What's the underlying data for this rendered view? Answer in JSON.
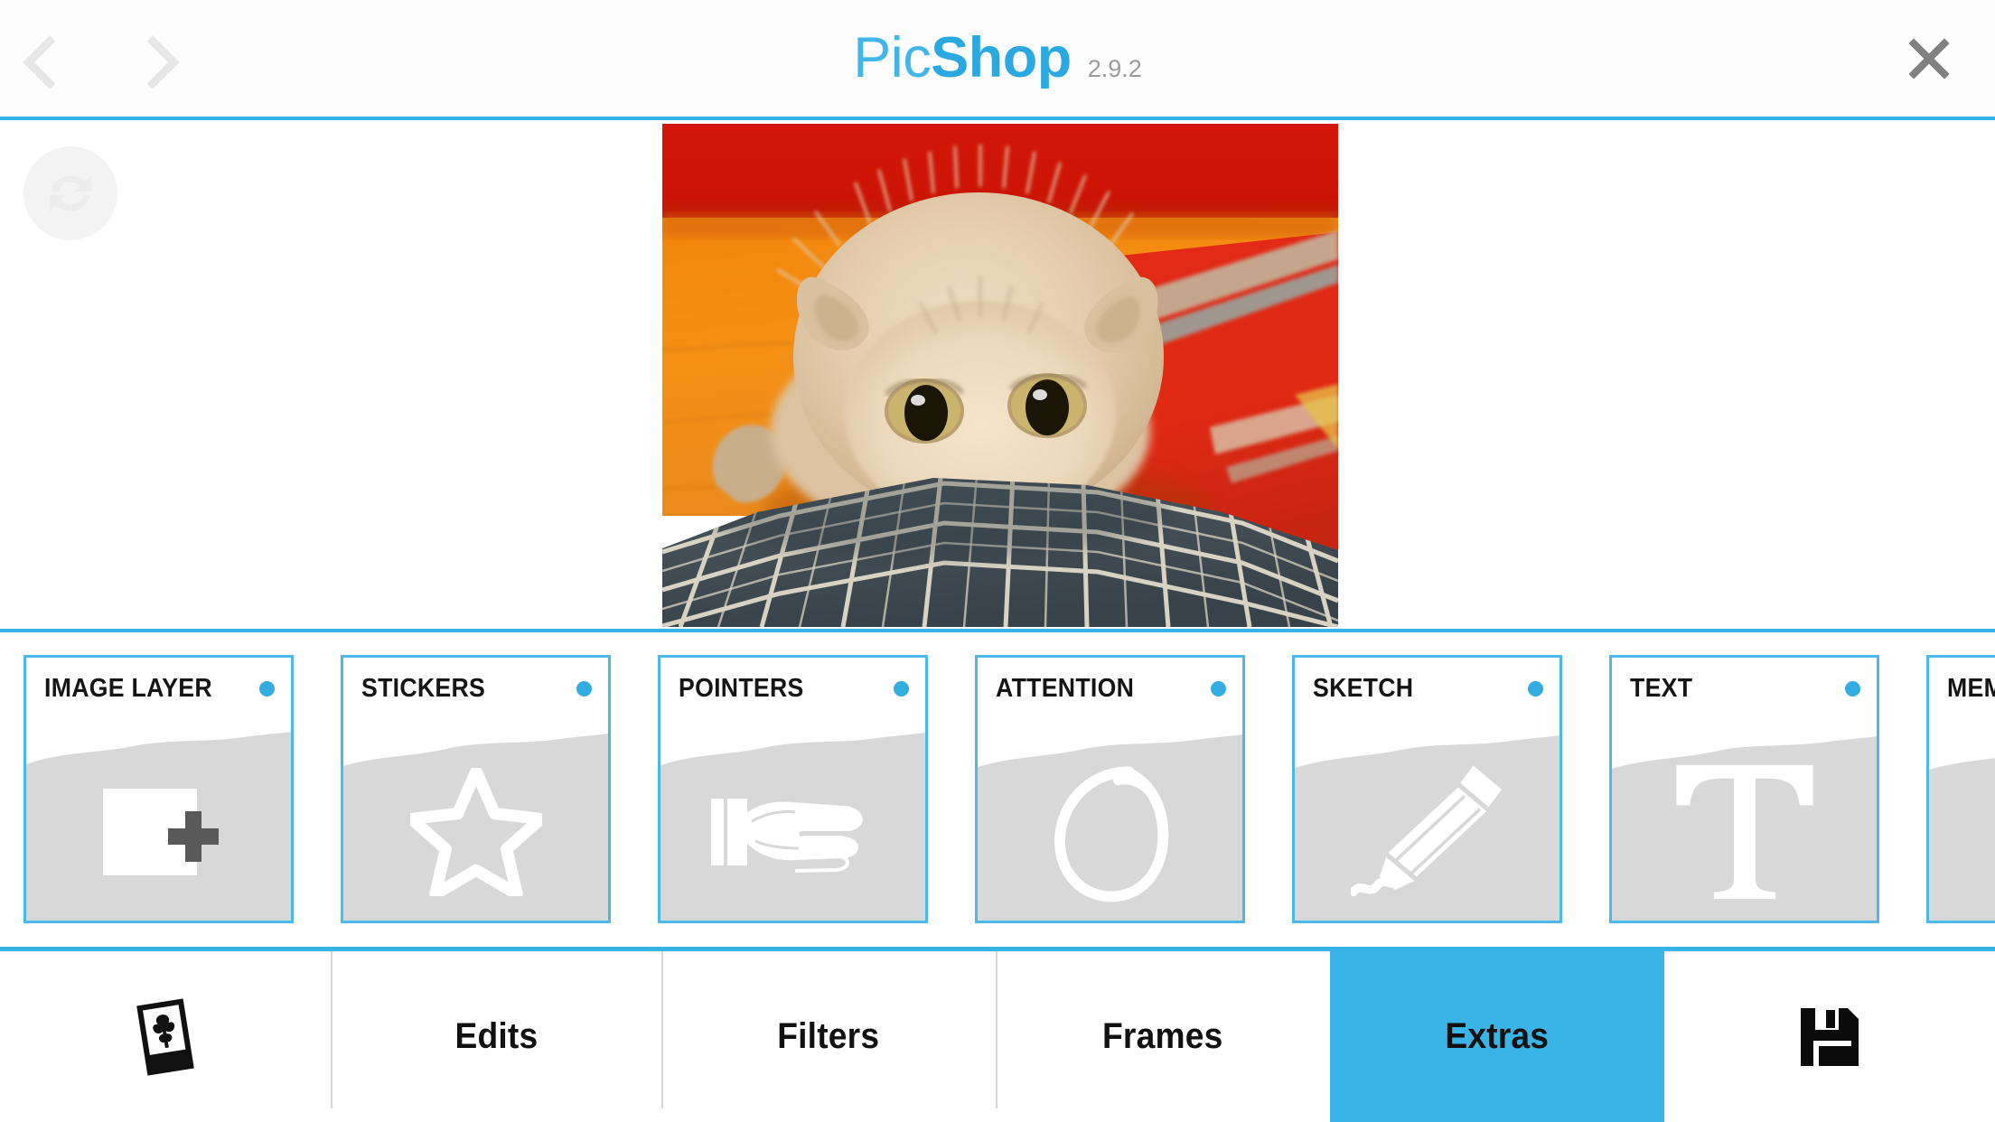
{
  "app": {
    "brand_first": "Pic",
    "brand_second": "Shop",
    "version": "2.9.2"
  },
  "colors": {
    "accent": "#35b2e6",
    "accent_active_tab": "#3ab4e6",
    "card_border": "#4cb9e8",
    "card_dot": "#33ace0",
    "card_body_gray": "#d8d8d8",
    "brand_light": "#42b6e8",
    "brand_bold": "#2aa8e0",
    "version_gray": "#9b9b9b",
    "close_gray": "#808080",
    "chevron_gray": "#e7e7e7"
  },
  "topbar": {
    "back_icon": "chevron-left-icon",
    "forward_icon": "chevron-right-icon",
    "close_icon": "close-x-icon"
  },
  "canvas": {
    "rotate_icon": "rotate-refresh-icon",
    "photo_alt": "kitten-photo"
  },
  "tools": {
    "cards": [
      {
        "label": "IMAGE LAYER",
        "icon": "add-image-icon",
        "dot": true
      },
      {
        "label": "STICKERS",
        "icon": "star-icon",
        "dot": true
      },
      {
        "label": "POINTERS",
        "icon": "pointing-hand-icon",
        "dot": true
      },
      {
        "label": "ATTENTION",
        "icon": "circle-scribble-icon",
        "dot": true
      },
      {
        "label": "SKETCH",
        "icon": "pencil-icon",
        "dot": true
      },
      {
        "label": "TEXT",
        "icon": "text-t-icon",
        "dot": true
      },
      {
        "label": "MEME",
        "icon": "meme-icon",
        "dot": true
      }
    ]
  },
  "bottomnav": {
    "items": [
      {
        "label": "",
        "icon": "gallery-photo-icon",
        "active": false
      },
      {
        "label": "Edits",
        "icon": "",
        "active": false
      },
      {
        "label": "Filters",
        "icon": "",
        "active": false
      },
      {
        "label": "Frames",
        "icon": "",
        "active": false
      },
      {
        "label": "Extras",
        "icon": "",
        "active": true
      },
      {
        "label": "",
        "icon": "save-floppy-icon",
        "active": false
      }
    ]
  }
}
